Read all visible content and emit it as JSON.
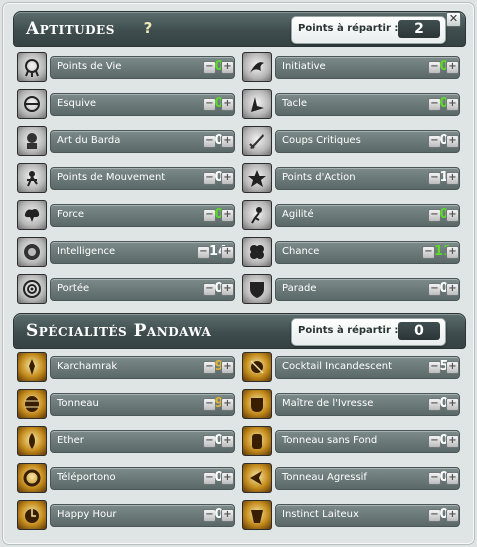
{
  "aptitudes": {
    "title": "Aptitudes",
    "help_glyph": "?",
    "points_label": "Points à répartir :",
    "points_value": "2",
    "close_glyph": "✕",
    "rows": [
      {
        "label": "Points de Vie",
        "value": "0",
        "color": "#5ed92b",
        "icon": "health-icon"
      },
      {
        "label": "Initiative",
        "value": "0",
        "color": "#5ed92b",
        "icon": "initiative-icon"
      },
      {
        "label": "Esquive",
        "value": "0",
        "color": "#5ed92b",
        "icon": "dodge-icon"
      },
      {
        "label": "Tacle",
        "value": "0",
        "color": "#5ed92b",
        "icon": "tackle-icon"
      },
      {
        "label": "Art du Barda",
        "value": "0",
        "color": "#ffffff",
        "icon": "barda-icon"
      },
      {
        "label": "Coups Critiques",
        "value": "0",
        "color": "#ffffff",
        "icon": "critical-icon"
      },
      {
        "label": "Points de Mouvement",
        "value": "0",
        "color": "#ffffff",
        "icon": "movement-icon"
      },
      {
        "label": "Points d'Action",
        "value": "1",
        "color": "#ffffff",
        "icon": "action-points-icon"
      },
      {
        "label": "Force",
        "value": "0",
        "color": "#5ed92b",
        "icon": "strength-icon"
      },
      {
        "label": "Agilité",
        "value": "0",
        "color": "#5ed92b",
        "icon": "agility-icon"
      },
      {
        "label": "Intelligence",
        "value": "14",
        "color": "#ffffff",
        "icon": "intelligence-icon"
      },
      {
        "label": "Chance",
        "value": "11",
        "color": "#5ed92b",
        "icon": "chance-icon"
      },
      {
        "label": "Portée",
        "value": "0",
        "color": "#ffffff",
        "icon": "range-icon"
      },
      {
        "label": "Parade",
        "value": "0",
        "color": "#ffffff",
        "icon": "parry-icon"
      }
    ]
  },
  "specialites": {
    "title": "Spécialités Pandawa",
    "points_label": "Points à répartir :",
    "points_value": "0",
    "rows": [
      {
        "label": "Karchamrak",
        "value": "9",
        "color": "#e0b437",
        "icon": "karchamrak-icon"
      },
      {
        "label": "Cocktail Incandescent",
        "value": "5",
        "color": "#ffffff",
        "icon": "cocktail-icon"
      },
      {
        "label": "Tonneau",
        "value": "9",
        "color": "#e0b437",
        "icon": "barrel-icon"
      },
      {
        "label": "Maître de l'Ivresse",
        "value": "0",
        "color": "#ffffff",
        "icon": "drunk-master-icon"
      },
      {
        "label": "Ether",
        "value": "0",
        "color": "#ffffff",
        "icon": "ether-icon"
      },
      {
        "label": "Tonneau sans Fond",
        "value": "0",
        "color": "#ffffff",
        "icon": "bottomless-barrel-icon"
      },
      {
        "label": "Téléportono",
        "value": "0",
        "color": "#ffffff",
        "icon": "teleport-icon"
      },
      {
        "label": "Tonneau Agressif",
        "value": "0",
        "color": "#ffffff",
        "icon": "aggressive-barrel-icon"
      },
      {
        "label": "Happy Hour",
        "value": "0",
        "color": "#ffffff",
        "icon": "happy-hour-icon"
      },
      {
        "label": "Instinct Laiteux",
        "value": "0",
        "color": "#ffffff",
        "icon": "milky-instinct-icon"
      }
    ]
  }
}
